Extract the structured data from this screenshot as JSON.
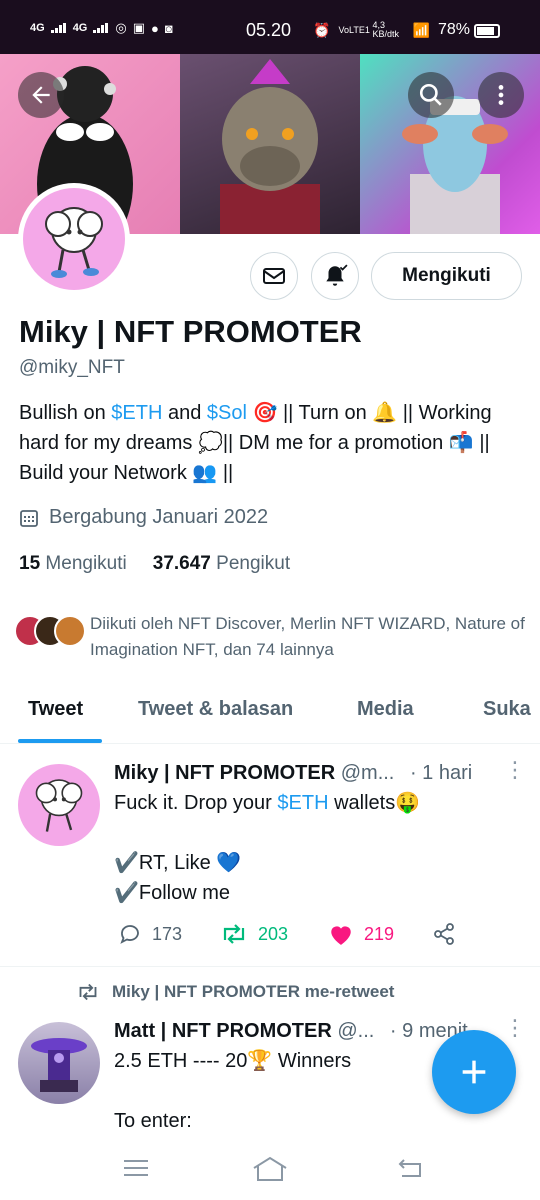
{
  "status_bar": {
    "network_1": "4G",
    "network_2": "4G",
    "time": "05.20",
    "volte": "VoLTE1",
    "speed": "4,3 KB/dtk",
    "battery": "78%"
  },
  "profile": {
    "name": "Miky | NFT PROMOTER",
    "handle": "@miky_NFT",
    "follow_label": "Mengikuti",
    "bio": {
      "p1": "Bullish on ",
      "eth": "$ETH",
      "p2": " and ",
      "sol": "$Sol",
      "p3": " 🎯 || Turn on 🔔 || Working hard for my dreams 💭|| DM me for a promotion 📬 || Build your Network 👥 ||"
    },
    "joined": "Bergabung Januari 2022",
    "following_count": "15",
    "following_label": "Mengikuti",
    "followers_count": "37.647",
    "followers_label": "Pengikut",
    "followed_by": "Diikuti oleh NFT Discover, Merlin NFT WIZARD, Nature of Imagination NFT, dan 74 lainnya"
  },
  "tabs": [
    {
      "label": "Tweet"
    },
    {
      "label": "Tweet & balasan"
    },
    {
      "label": "Media"
    },
    {
      "label": "Suka"
    }
  ],
  "tweet1": {
    "name": "Miky | NFT PROMOTER",
    "handle": "@m...",
    "time": "· 1 hari",
    "line1_a": "Fuck it. Drop your ",
    "line1_eth": "$ETH",
    "line1_b": " wallets🤑",
    "line2": "✔️RT, Like 💙",
    "line3": "✔️Follow me",
    "replies": "173",
    "retweets": "203",
    "likes": "219"
  },
  "retweet_line": "Miky | NFT PROMOTER me-retweet",
  "tweet2": {
    "name": "Matt | NFT PROMOTER",
    "handle": "@...",
    "time": "· 9 menit",
    "line1": "2.5 ETH ---- 20🏆 Winners",
    "line2": "To enter:"
  },
  "colors": {
    "accent": "#1d9bf0",
    "retweet": "#00ba7c",
    "like": "#f91880"
  }
}
